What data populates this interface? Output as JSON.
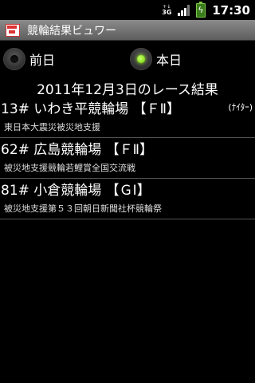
{
  "status_bar": {
    "network": {
      "top": "+↓",
      "label": "3G"
    },
    "signal_icon": "signal-icon",
    "battery_icon": "battery-charging-icon",
    "time": "17:30"
  },
  "title_bar": {
    "icon": "app-icon",
    "title": "競輪結果ビュワー"
  },
  "day_selector": {
    "options": [
      {
        "label": "前日",
        "checked": false
      },
      {
        "label": "本日",
        "checked": true
      }
    ]
  },
  "result_heading": "2011年12月3日のレース結果",
  "races": [
    {
      "heading": "13# いわき平競輪場 【ＦⅡ】",
      "tag": "(ﾅｲﾀｰ)",
      "description": "東日本大震災被災地支援"
    },
    {
      "heading": "62# 広島競輪場 【ＦⅡ】",
      "tag": "",
      "description": "被災地支援競輪若鯉賞全国交流戦"
    },
    {
      "heading": "81# 小倉競輪場 【ＧⅠ】",
      "tag": "",
      "description": "被災地支援第５３回朝日新聞社杯競輪祭"
    }
  ]
}
